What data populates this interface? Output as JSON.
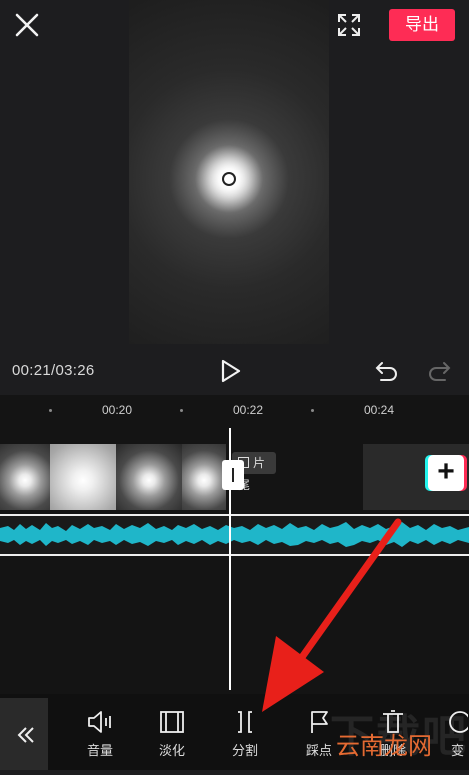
{
  "header": {
    "export_label": "导出"
  },
  "player": {
    "time": "00:21/03:26"
  },
  "ruler": {
    "ticks": [
      "00:20",
      "00:22",
      "00:24"
    ]
  },
  "timeline": {
    "tail_label": "片尾",
    "add_label": "+"
  },
  "toolbar": {
    "tools": [
      {
        "label": "音量",
        "icon": "volume-icon"
      },
      {
        "label": "淡化",
        "icon": "fade-icon"
      },
      {
        "label": "分割",
        "icon": "split-icon"
      },
      {
        "label": "踩点",
        "icon": "beat-flag-icon"
      },
      {
        "label": "删除",
        "icon": "delete-icon"
      },
      {
        "label": "变",
        "icon": "speed-icon"
      }
    ]
  },
  "watermark": {
    "text": "下载吧",
    "site": "云南龙网"
  },
  "colors": {
    "accent": "#fe2c55",
    "audio": "#1fb6c9",
    "annotation_arrow": "#e8201a"
  }
}
